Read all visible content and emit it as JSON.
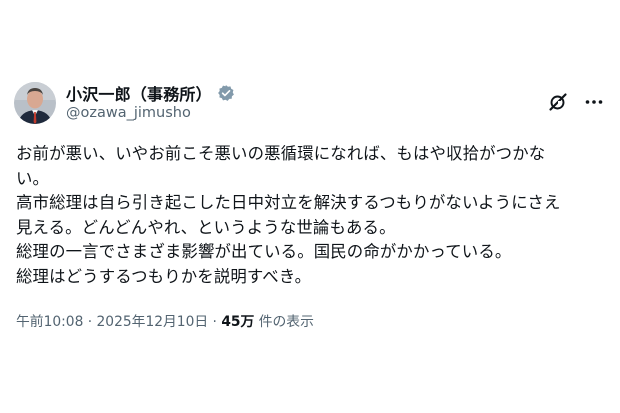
{
  "author": {
    "display_name": "小沢一郎（事務所）",
    "handle": "@ozawa_jimusho",
    "verified": true,
    "avatar_icon": "person-portrait-icon"
  },
  "header_actions": {
    "grok_icon": "grok-slash-icon",
    "more_icon": "more-dots-icon"
  },
  "post": {
    "lines": [
      "お前が悪い、いやお前こそ悪いの悪循環になれば、もはや収拾がつかな",
      "い。",
      "高市総理は自ら引き起こした日中対立を解決するつもりがないようにさえ",
      "見える。どんどんやれ、というような世論もある。",
      "総理の一言でさまざま影響が出ている。国民の命がかかっている。",
      "総理はどうするつもりかを説明すべき。"
    ]
  },
  "meta": {
    "time": "午前10:08",
    "separator": " · ",
    "date": "2025年12月10日",
    "separator2": " · ",
    "views_count": "45万",
    "views_label": " 件の表示"
  },
  "colors": {
    "text": "#0f1419",
    "secondary": "#536471",
    "verified_badge": "#829aab"
  }
}
